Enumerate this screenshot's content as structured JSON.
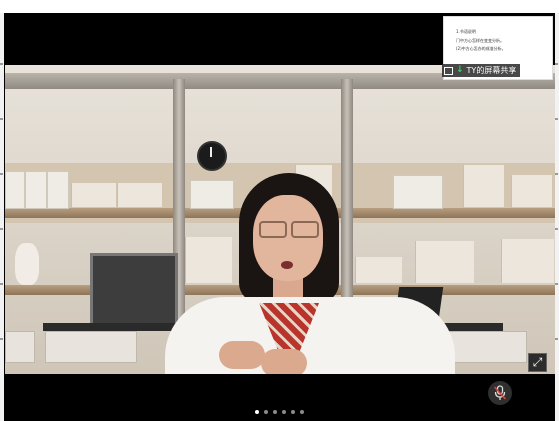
{
  "screen_share": {
    "label": "TY的屏幕共享",
    "slide_lines": [
      "1.节语说明",
      "门中方心怎样在变变分析。",
      "(2)中方心怎办的成准分析。"
    ]
  },
  "controls": {
    "expand_icon": "expand-icon",
    "mic_icon": "microphone-muted-icon",
    "pager_count": 6,
    "pager_active_index": 0
  },
  "colors": {
    "background": "#000000",
    "share_green": "#3ccf63"
  }
}
